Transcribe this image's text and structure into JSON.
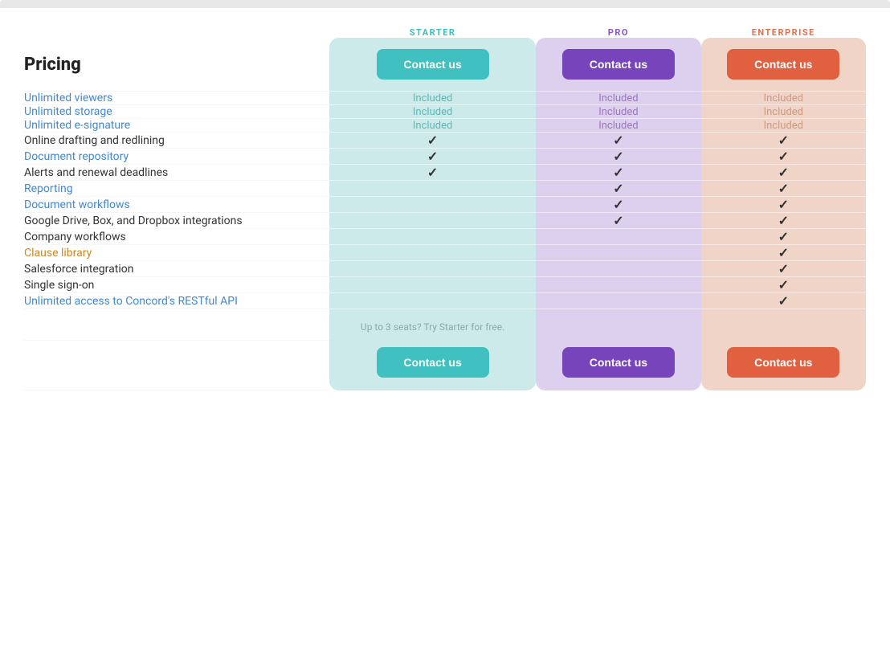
{
  "page": {
    "title": "Pricing"
  },
  "plans": [
    {
      "id": "starter",
      "label": "STARTER",
      "btnClass": "s",
      "colorClass": "starter"
    },
    {
      "id": "pro",
      "label": "PRO",
      "btnClass": "p",
      "colorClass": "pro"
    },
    {
      "id": "enterprise",
      "label": "ENTERPRISE",
      "btnClass": "e",
      "colorClass": "enterprise"
    }
  ],
  "contact_us": "Contact us",
  "free_trial_note": "Up to 3 seats? Try Starter for free.",
  "features": [
    {
      "label": "Unlimited viewers",
      "style": "blue",
      "starter": "Included",
      "pro": "Included",
      "enterprise": "Included"
    },
    {
      "label": "Unlimited storage",
      "style": "blue",
      "starter": "Included",
      "pro": "Included",
      "enterprise": "Included"
    },
    {
      "label": "Unlimited e-signature",
      "style": "blue",
      "starter": "Included",
      "pro": "Included",
      "enterprise": "Included"
    },
    {
      "label": "Online drafting and redlining",
      "style": "dark",
      "starter": "check",
      "pro": "check",
      "enterprise": "check"
    },
    {
      "label": "Document repository",
      "style": "blue",
      "starter": "check",
      "pro": "check",
      "enterprise": "check"
    },
    {
      "label": "Alerts and renewal deadlines",
      "style": "dark",
      "starter": "check",
      "pro": "check",
      "enterprise": "check"
    },
    {
      "label": "Reporting",
      "style": "blue",
      "starter": "",
      "pro": "check",
      "enterprise": "check"
    },
    {
      "label": "Document workflows",
      "style": "blue",
      "starter": "",
      "pro": "check",
      "enterprise": "check"
    },
    {
      "label": "Google Drive, Box, and Dropbox integrations",
      "style": "dark",
      "starter": "",
      "pro": "check",
      "enterprise": "check"
    },
    {
      "label": "Company workflows",
      "style": "dark",
      "starter": "",
      "pro": "",
      "enterprise": "check"
    },
    {
      "label": "Clause library",
      "style": "amber",
      "starter": "",
      "pro": "",
      "enterprise": "check"
    },
    {
      "label": "Salesforce integration",
      "style": "dark",
      "starter": "",
      "pro": "",
      "enterprise": "check"
    },
    {
      "label": "Single sign-on",
      "style": "dark",
      "starter": "",
      "pro": "",
      "enterprise": "check"
    },
    {
      "label": "Unlimited access to Concord's RESTful API",
      "style": "blue",
      "starter": "",
      "pro": "",
      "enterprise": "check"
    }
  ]
}
